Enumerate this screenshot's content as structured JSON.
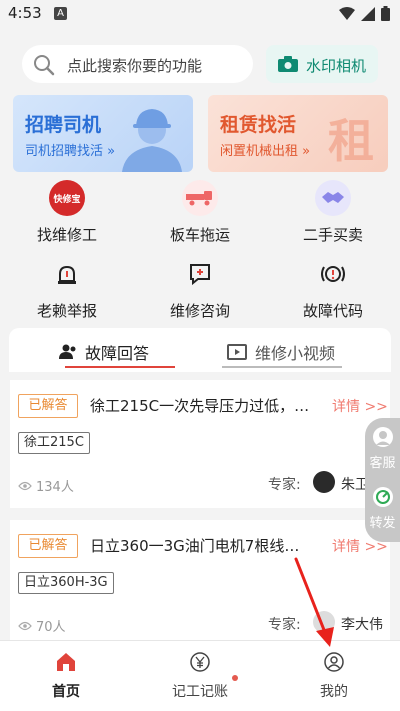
{
  "status_bar": {
    "time": "4:53",
    "notif": "A"
  },
  "search": {
    "placeholder": "点此搜索你要的功能"
  },
  "watermark_button": {
    "label": "水印相机"
  },
  "banners": [
    {
      "title": "招聘司机",
      "subtitle": "司机招聘找活 »"
    },
    {
      "title": "租赁找活",
      "subtitle": "闲置机械出租 »",
      "deco": "租"
    }
  ],
  "grid": [
    {
      "label": "找维修工",
      "icon": "kuaixiubao-logo-icon",
      "badge": "快修宝"
    },
    {
      "label": "板车拖运",
      "icon": "truck-icon"
    },
    {
      "label": "二手买卖",
      "icon": "handshake-icon"
    },
    {
      "label": "老赖举报",
      "icon": "alarm-icon"
    },
    {
      "label": "维修咨询",
      "icon": "consult-icon"
    },
    {
      "label": "故障代码",
      "icon": "fault-code-icon"
    }
  ],
  "tabs": [
    {
      "label": "故障回答",
      "active": true
    },
    {
      "label": "维修小视频",
      "active": false
    }
  ],
  "qa_list": [
    {
      "status": "已解答",
      "title": "徐工215C一次先导压力过低，…",
      "detail": "详情 >>",
      "tag": "徐工215C",
      "views": "134人",
      "expert_label": "专家:",
      "expert_name": "朱卫东"
    },
    {
      "status": "已解答",
      "title": "日立360一3G油门电机7根线…",
      "detail": "详情 >>",
      "tag": "日立360H-3G",
      "views": "70人",
      "expert_label": "专家:",
      "expert_name": "李大伟"
    }
  ],
  "float_bar": {
    "service": "客服",
    "share": "转发"
  },
  "bottom_nav": [
    {
      "label": "首页",
      "active": true
    },
    {
      "label": "记工记账",
      "active": false
    },
    {
      "label": "我的",
      "active": false
    }
  ],
  "colors": {
    "accent_red": "#e0443b",
    "teal": "#0f8a72",
    "orange": "#e98a33"
  }
}
